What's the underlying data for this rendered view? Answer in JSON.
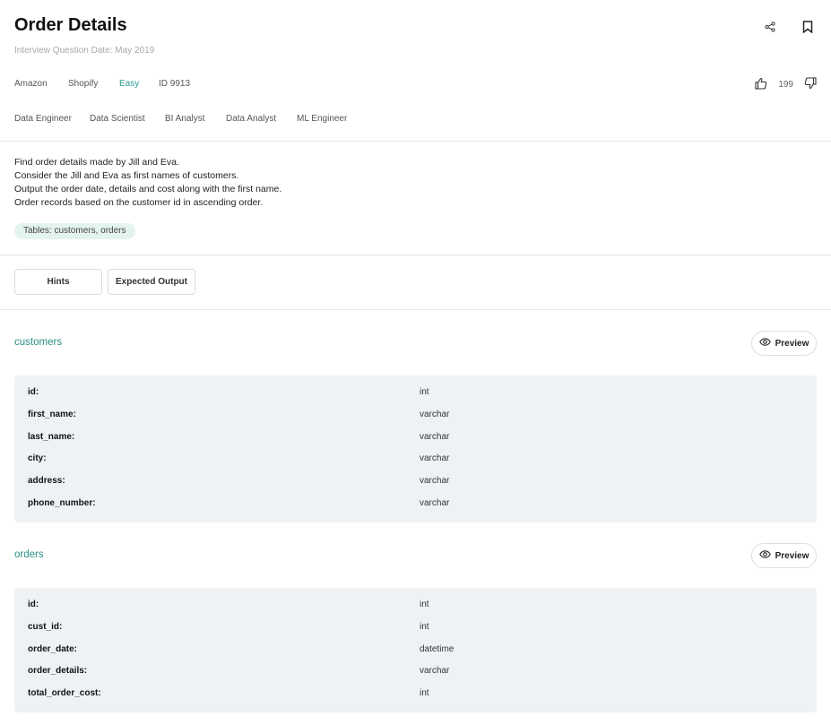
{
  "header": {
    "title": "Order Details",
    "date": "Interview Question Date: May 2019"
  },
  "meta": {
    "companies": [
      "Amazon",
      "Shopify"
    ],
    "difficulty": "Easy",
    "id": "ID 9913",
    "upvotes": "199"
  },
  "roles": [
    "Data Engineer",
    "Data Scientist",
    "BI Analyst",
    "Data Analyst",
    "ML Engineer"
  ],
  "description": [
    "Find order details made by Jill and Eva.",
    "Consider the Jill and Eva as first names of customers.",
    "Output the order date, details and cost along with the first name.",
    "Order records based on the customer id in ascending order."
  ],
  "tables_pill": "Tables: customers, orders",
  "tabs": {
    "hints": "Hints",
    "expected_output": "Expected Output"
  },
  "preview_label": "Preview",
  "schemas": [
    {
      "name": "customers",
      "columns": [
        {
          "name": "id:",
          "type": "int"
        },
        {
          "name": "first_name:",
          "type": "varchar"
        },
        {
          "name": "last_name:",
          "type": "varchar"
        },
        {
          "name": "city:",
          "type": "varchar"
        },
        {
          "name": "address:",
          "type": "varchar"
        },
        {
          "name": "phone_number:",
          "type": "varchar"
        }
      ]
    },
    {
      "name": "orders",
      "columns": [
        {
          "name": "id:",
          "type": "int"
        },
        {
          "name": "cust_id:",
          "type": "int"
        },
        {
          "name": "order_date:",
          "type": "datetime"
        },
        {
          "name": "order_details:",
          "type": "varchar"
        },
        {
          "name": "total_order_cost:",
          "type": "int"
        }
      ]
    }
  ],
  "colors": {
    "accent": "#2a9d8f",
    "schema_bg": "#eff2f5",
    "pill_bg": "#e3f3ef"
  }
}
